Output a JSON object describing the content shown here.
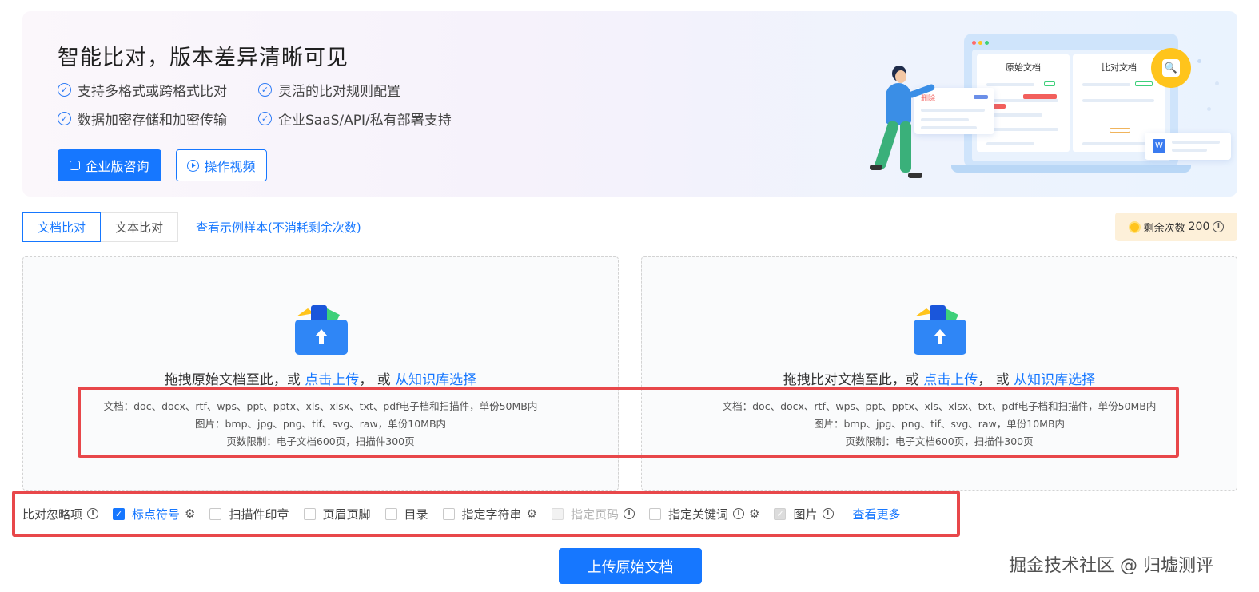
{
  "banner": {
    "title": "智能比对，版本差异清晰可见",
    "features": [
      "支持多格式或跨格式比对",
      "灵活的比对规则配置",
      "数据加密存储和加密传输",
      "企业SaaS/API/私有部署支持"
    ],
    "consult_button": "企业版咨询",
    "video_button": "操作视频",
    "illustration": {
      "original_doc_label": "原始文档",
      "compare_doc_label": "比对文档",
      "delete_label": "删除",
      "word_icon_letter": "W"
    }
  },
  "tabs": [
    {
      "label": "文档比对",
      "active": true
    },
    {
      "label": "文本比对",
      "active": false
    }
  ],
  "sample_link": "查看示例样本(不消耗剩余次数)",
  "remaining": {
    "label": "剩余次数",
    "count": "200"
  },
  "upload_left": {
    "prompt_prefix": "拖拽原始文档至此，或",
    "click_upload": "点击上传",
    "separator": "， 或",
    "kb_select": "从知识库选择"
  },
  "upload_right": {
    "prompt_prefix": "拖拽比对文档至此，或",
    "click_upload": "点击上传",
    "separator": "， 或",
    "kb_select": "从知识库选择"
  },
  "formats": {
    "documents": "文档：doc、docx、rtf、wps、ppt、pptx、xls、xlsx、txt、pdf电子档和扫描件，单份50MB内",
    "images": "图片：bmp、jpg、png、tif、svg、raw，单份10MB内",
    "pages": "页数限制：电子文档600页，扫描件300页"
  },
  "options": {
    "label": "比对忽略项",
    "items": [
      {
        "label": "标点符号",
        "checked": true,
        "disabled": false,
        "gear": true,
        "info": false
      },
      {
        "label": "扫描件印章",
        "checked": false,
        "disabled": false,
        "gear": false,
        "info": false
      },
      {
        "label": "页眉页脚",
        "checked": false,
        "disabled": false,
        "gear": false,
        "info": false
      },
      {
        "label": "目录",
        "checked": false,
        "disabled": false,
        "gear": false,
        "info": false
      },
      {
        "label": "指定字符串",
        "checked": false,
        "disabled": false,
        "gear": true,
        "info": false
      },
      {
        "label": "指定页码",
        "checked": false,
        "disabled": true,
        "gear": false,
        "info": true
      },
      {
        "label": "指定关键词",
        "checked": false,
        "disabled": false,
        "gear": true,
        "info": true
      },
      {
        "label": "图片",
        "checked": true,
        "disabled": true,
        "gear": false,
        "info": true
      }
    ],
    "more_link": "查看更多"
  },
  "upload_button": "上传原始文档",
  "watermark": "掘金技术社区 @ 归墟测评",
  "colors": {
    "primary": "#1677ff",
    "annotation_red": "#e8474a",
    "coin": "#ffc41c",
    "remain_bg": "#fdf0d9"
  }
}
